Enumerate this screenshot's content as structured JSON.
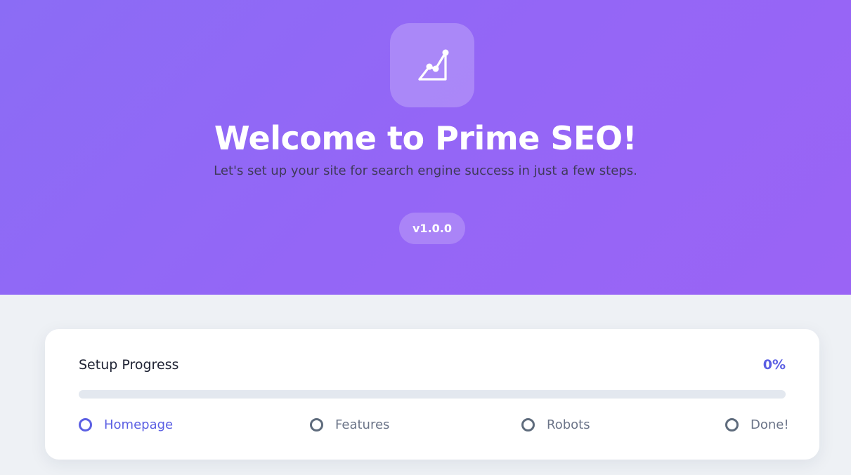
{
  "hero": {
    "title": "Welcome to Prime SEO!",
    "subtitle": "Let's set up your site for search engine success in just a few steps.",
    "version": "v1.0.0",
    "logo_icon": "chart-line-up-icon"
  },
  "progress": {
    "title": "Setup Progress",
    "percent_label": "0%",
    "value": 0,
    "steps": [
      {
        "label": "Homepage",
        "active": true
      },
      {
        "label": "Features",
        "active": false
      },
      {
        "label": "Robots",
        "active": false
      },
      {
        "label": "Done!",
        "active": false
      }
    ]
  },
  "colors": {
    "hero_gradient_start": "#8b6cf5",
    "hero_gradient_end": "#9a64f5",
    "accent": "#5b5fe3",
    "background": "#eef1f5"
  }
}
